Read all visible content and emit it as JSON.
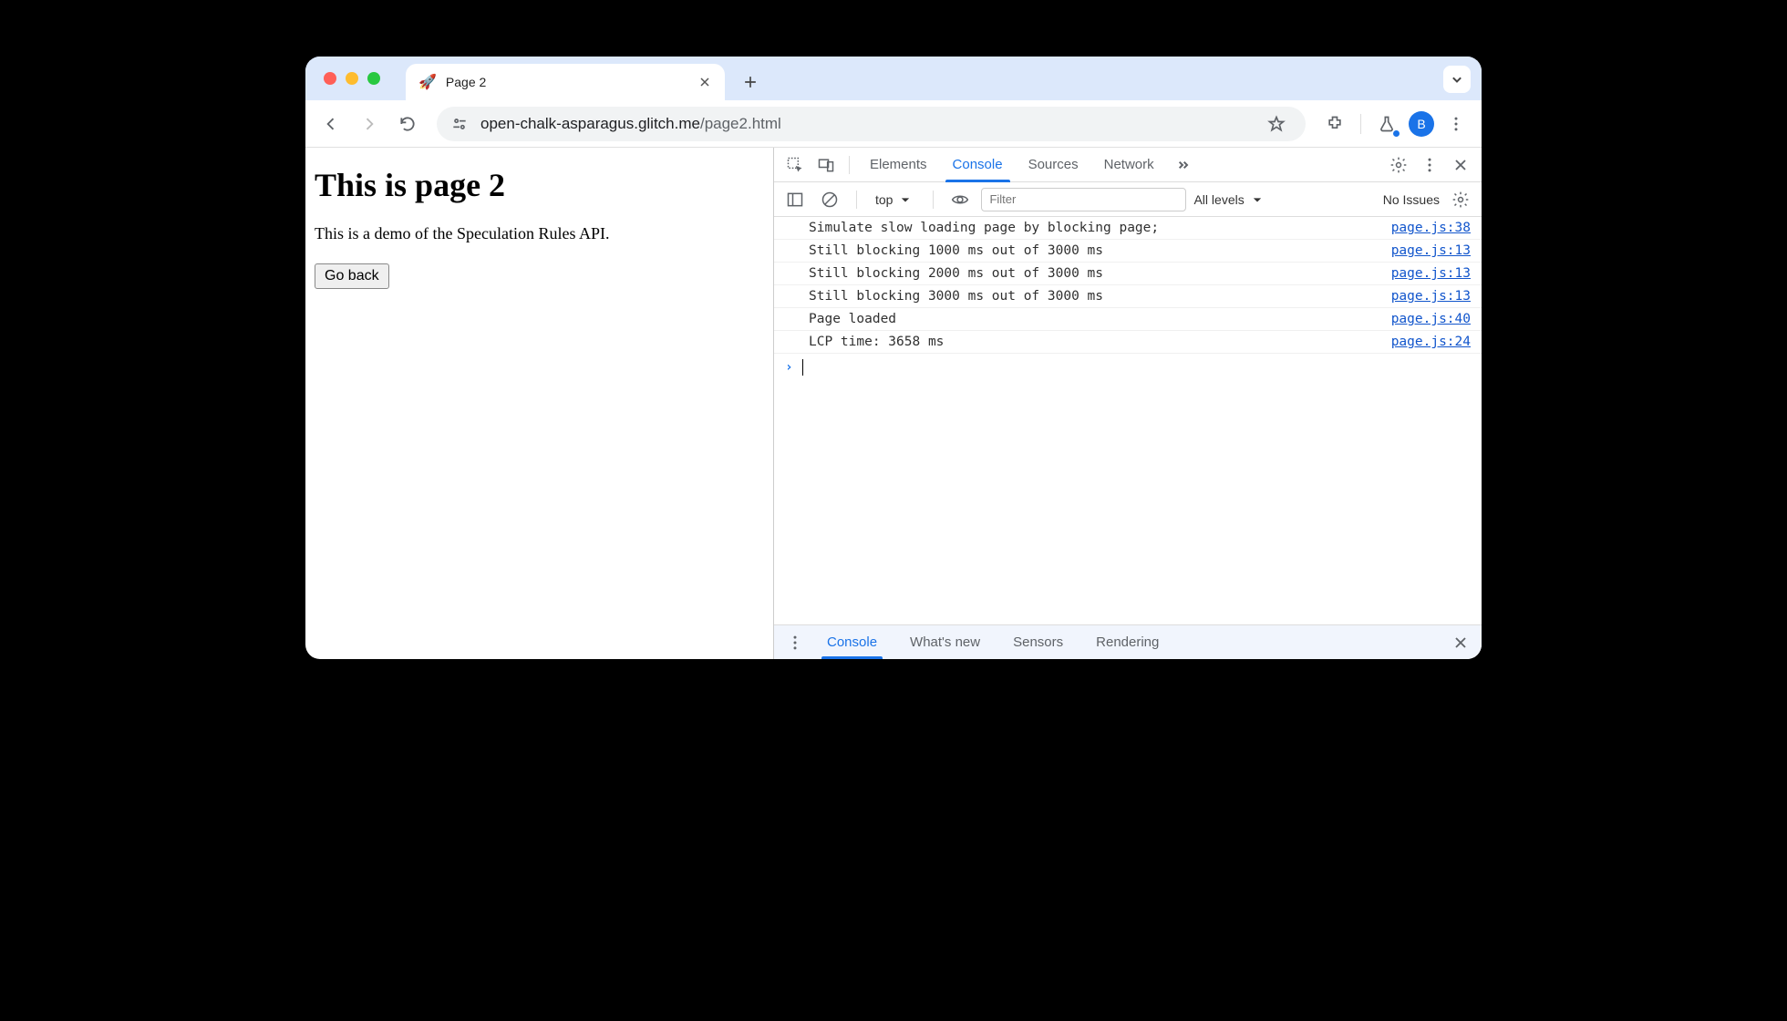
{
  "browser": {
    "tab_icon": "🚀",
    "tab_title": "Page 2",
    "url_host": "open-chalk-asparagus.glitch.me",
    "url_path": "/page2.html",
    "avatar_letter": "B"
  },
  "page": {
    "heading": "This is page 2",
    "body": "This is a demo of the Speculation Rules API.",
    "button_label": "Go back"
  },
  "devtools": {
    "tabs": [
      "Elements",
      "Console",
      "Sources",
      "Network"
    ],
    "active_tab": "Console",
    "context": "top",
    "filter_placeholder": "Filter",
    "levels_label": "All levels",
    "issues_label": "No Issues",
    "log": [
      {
        "msg": "Simulate slow loading page by blocking page;",
        "src": "page.js:38"
      },
      {
        "msg": "Still blocking 1000 ms out of 3000 ms",
        "src": "page.js:13"
      },
      {
        "msg": "Still blocking 2000 ms out of 3000 ms",
        "src": "page.js:13"
      },
      {
        "msg": "Still blocking 3000 ms out of 3000 ms",
        "src": "page.js:13"
      },
      {
        "msg": "Page loaded",
        "src": "page.js:40"
      },
      {
        "msg": "LCP time: 3658 ms",
        "src": "page.js:24"
      }
    ],
    "drawer_tabs": [
      "Console",
      "What's new",
      "Sensors",
      "Rendering"
    ],
    "drawer_active": "Console"
  }
}
